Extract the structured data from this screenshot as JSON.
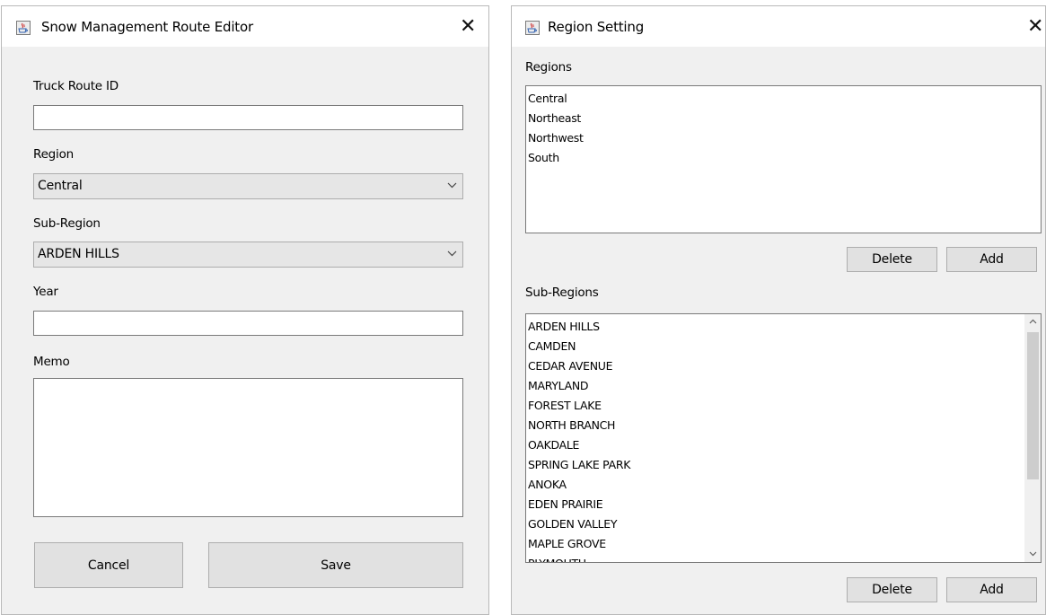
{
  "route_editor": {
    "title": "Snow Management Route Editor",
    "close_glyph": "✕",
    "truck_route_id": {
      "label": "Truck Route ID",
      "value": ""
    },
    "region": {
      "label": "Region",
      "selected": "Central"
    },
    "sub_region": {
      "label": "Sub-Region",
      "selected": "ARDEN HILLS"
    },
    "year": {
      "label": "Year",
      "value": ""
    },
    "memo": {
      "label": "Memo",
      "value": ""
    },
    "cancel_label": "Cancel",
    "save_label": "Save"
  },
  "region_setting": {
    "title": "Region Setting",
    "close_glyph": "✕",
    "regions_label": "Regions",
    "regions": [
      "Central",
      "Northeast",
      "Northwest",
      "South"
    ],
    "regions_delete_label": "Delete",
    "regions_add_label": "Add",
    "sub_regions_label": "Sub-Regions",
    "sub_regions": [
      "ARDEN HILLS",
      "CAMDEN",
      "CEDAR AVENUE",
      "MARYLAND",
      "FOREST LAKE",
      "NORTH BRANCH",
      "OAKDALE",
      "SPRING LAKE PARK",
      "ANOKA",
      "EDEN PRAIRIE",
      "GOLDEN VALLEY",
      "MAPLE GROVE",
      "PLYMOUTH"
    ],
    "sub_regions_delete_label": "Delete",
    "sub_regions_add_label": "Add"
  },
  "icons": {
    "app_icon": "java-cup-icon",
    "close": "close-icon",
    "dropdown": "chevron-down-icon",
    "scroll_up": "arrow-up-icon",
    "scroll_down": "arrow-down-icon"
  },
  "colors": {
    "window_bg": "#f0f0f0",
    "titlebar_bg": "#ffffff",
    "button_bg": "#e1e1e1",
    "combo_bg": "#e6e6e6",
    "border": "#7a7a7a",
    "java_icon_red": "#d04040",
    "java_icon_blue": "#3060b0"
  }
}
